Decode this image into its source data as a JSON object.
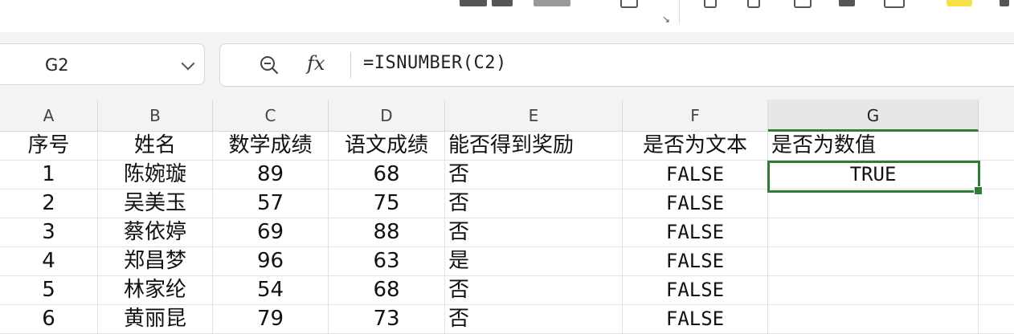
{
  "formula_bar": {
    "cell_ref": "G2",
    "formula": "=ISNUMBER(C2)"
  },
  "columns": [
    "A",
    "B",
    "C",
    "D",
    "E",
    "F",
    "G"
  ],
  "active_column": "G",
  "sheet": {
    "header": [
      "序号",
      "姓名",
      "数学成绩",
      "语文成绩",
      "能否得到奖励",
      "是否为文本",
      "是否为数值"
    ],
    "rows": [
      [
        "1",
        "陈婉璇",
        "89",
        "68",
        "否",
        "FALSE",
        "TRUE"
      ],
      [
        "2",
        "吴美玉",
        "57",
        "75",
        "否",
        "FALSE",
        ""
      ],
      [
        "3",
        "蔡依婷",
        "69",
        "88",
        "否",
        "FALSE",
        ""
      ],
      [
        "4",
        "郑昌梦",
        "96",
        "63",
        "是",
        "FALSE",
        ""
      ],
      [
        "5",
        "林家纶",
        "54",
        "68",
        "否",
        "FALSE",
        ""
      ],
      [
        "6",
        "黄丽昆",
        "79",
        "73",
        "否",
        "FALSE",
        ""
      ]
    ]
  },
  "colors": {
    "selection": "#2e7d32",
    "header_bg": "#f3f3f3",
    "ribbon_accent": "#f5e04a"
  },
  "icons": [
    "zoom-icon",
    "function-icon",
    "chevron-down-icon",
    "dialog-launcher-icon"
  ]
}
